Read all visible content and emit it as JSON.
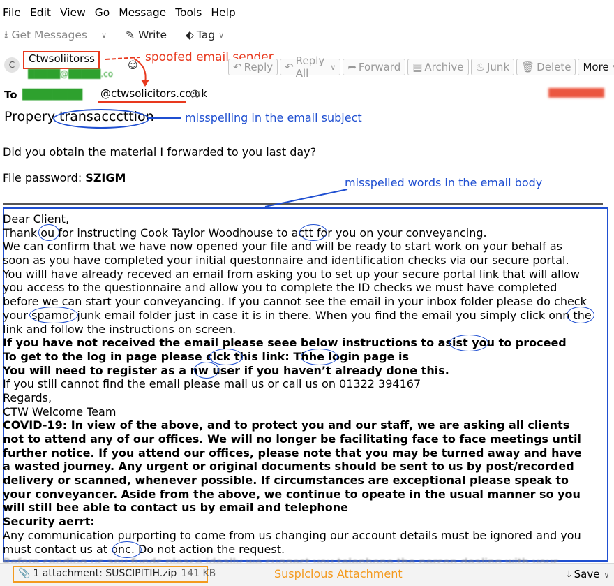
{
  "menu": [
    "File",
    "Edit",
    "View",
    "Go",
    "Message",
    "Tools",
    "Help"
  ],
  "toolbar": {
    "get_messages": "Get Messages",
    "write": "Write",
    "tag": "Tag"
  },
  "header": {
    "avatar_letter": "C",
    "sender_name": "Ctwsoliitorss",
    "sender_email_redacted": "█████@█████.co",
    "buttons": [
      "Reply",
      "Reply All",
      "Forward",
      "Archive",
      "Junk",
      "Delete",
      "More"
    ],
    "to_label": "To",
    "to_local_redacted": "████████",
    "to_domain": "@ctwsolicitors.co.uk",
    "subject": "Propery transacccttion"
  },
  "annotations": {
    "spoofed": "spoofed email sender",
    "subject_misspelling": "misspelling in the email subject",
    "body_misspelled": "misspelled words in the email body",
    "attachment": "Suspicious Attachment"
  },
  "message": {
    "line1": "Did you obtain the material I forwarded to you last day?",
    "password_label": "File password: ",
    "password_value": "SZIGM",
    "body_lines": [
      {
        "text": "Dear Client,",
        "bold": false
      },
      {
        "text": "Thank ou for instructing Cook Taylor Woodhouse to actt for you on your conveyancing.",
        "bold": false
      },
      {
        "text": "We can confirm that we have now opened your file and will be ready to start work on your behalf as",
        "bold": false
      },
      {
        "text": "soon as you have completed your initial questonnaire and identification checks via our secure portal.",
        "bold": false
      },
      {
        "text": "You willl have already receved an email from asking you to set up your secure portal link that will allow",
        "bold": false
      },
      {
        "text": "you access to the questionnaire and allow you to complete the ID checks we must have completed",
        "bold": false
      },
      {
        "text": "before we can start your conveyancing. If you cannot see the email in your inbox folder please do check",
        "bold": false
      },
      {
        "text": "your spamor junk email folder just in case it is in there. When you find the email you simply click onn the",
        "bold": false
      },
      {
        "text": "link and follow the instructions on screen.",
        "bold": false
      },
      {
        "text": "If you have not received the email please seee below instructions to asist you to proceed",
        "bold": true
      },
      {
        "text": "To get to the log in page please clck this link: Thhe login page is",
        "bold": true
      },
      {
        "text": "You will need to register as a nw user if you haven’t already done this.",
        "bold": true
      },
      {
        "text": "If you still cannot find the email please mail us or call us on 01322 394167",
        "bold": false
      },
      {
        "text": "Regards,",
        "bold": false
      },
      {
        "text": "CTW Welcome Team",
        "bold": false
      },
      {
        "text": "COVID-19: In view of the above, and to protect you and our staff, we are asking all clients",
        "bold": true
      },
      {
        "text": "not to attend any of our offices. We will no longer be facilitating face to face meetings until",
        "bold": true
      },
      {
        "text": "further notice. If you attend our offices, please note that you may be turned away and have",
        "bold": true
      },
      {
        "text": "a wasted journey. Any urgent or original documents should be sent to us by post/recorded",
        "bold": true
      },
      {
        "text": "delivery or scanned, whenever possible. If circumstances are exceptional please speak to",
        "bold": true
      },
      {
        "text": "your conveyancer. Aside from the above, we continue to opeate in the usual manner so you",
        "bold": true
      },
      {
        "text": "will still bee able to contact us by email and telephone",
        "bold": true
      },
      {
        "text": "Security aerrt:",
        "bold": true
      },
      {
        "text": "Any communication purporting to come from us changing our account details must be ignored and you",
        "bold": false
      },
      {
        "text": "must contact us at onc. Do not action the request.",
        "bold": false
      }
    ],
    "cut_line": "Before sending us any funds please ideally we suggest you telephone the person dealing with your"
  },
  "attachment": {
    "label": "1 attachment: SUSCIPITIH.zip",
    "size": "141 KB",
    "save": "Save"
  }
}
